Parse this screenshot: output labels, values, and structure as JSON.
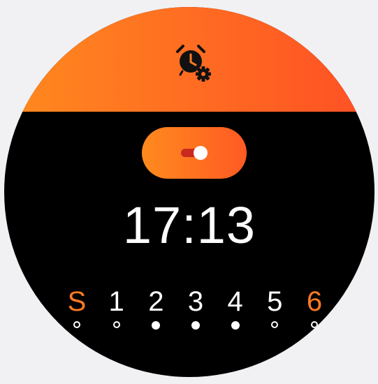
{
  "header": {
    "icon": "alarm-settings-icon",
    "accent_color": "#ff6a22"
  },
  "toggle": {
    "state": "on"
  },
  "alarm": {
    "time": "17:13"
  },
  "days": [
    {
      "label": "S",
      "active": false,
      "weekend": true
    },
    {
      "label": "1",
      "active": false,
      "weekend": false
    },
    {
      "label": "2",
      "active": true,
      "weekend": false
    },
    {
      "label": "3",
      "active": true,
      "weekend": false
    },
    {
      "label": "4",
      "active": true,
      "weekend": false
    },
    {
      "label": "5",
      "active": false,
      "weekend": false
    },
    {
      "label": "6",
      "active": false,
      "weekend": true
    }
  ]
}
